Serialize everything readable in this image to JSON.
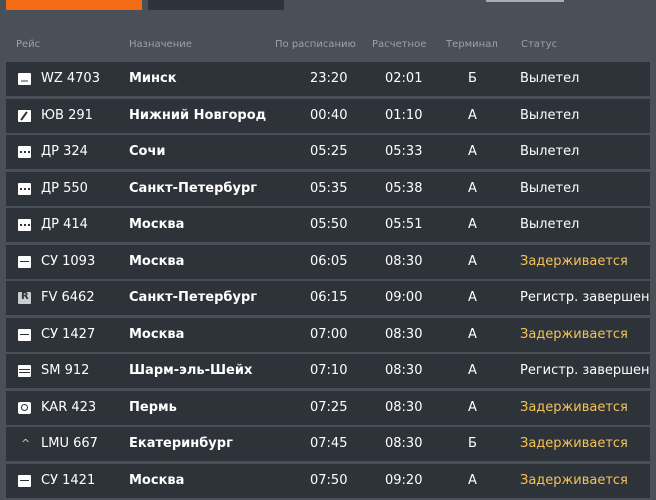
{
  "header": {
    "flight": "Рейс",
    "destination": "Назначение",
    "scheduled": "По расписанию",
    "estimated": "Расчетное",
    "terminal": "Терминал",
    "status": "Статус"
  },
  "flights": [
    {
      "icon": "wizz-icon",
      "icon_class": "wizz",
      "flight": "WZ 4703",
      "destination": "Минск",
      "scheduled": "23:20",
      "estimated": "02:01",
      "terminal": "Б",
      "status": "Вылетел",
      "delayed": false
    },
    {
      "icon": "slash-logo-icon",
      "icon_class": "slash",
      "flight": "ЮВ 291",
      "destination": "Нижний Новгород",
      "scheduled": "00:40",
      "estimated": "01:10",
      "terminal": "А",
      "status": "Вылетел",
      "delayed": false
    },
    {
      "icon": "dots-logo-icon",
      "icon_class": "dots",
      "flight": "ДР 324",
      "destination": "Сочи",
      "scheduled": "05:25",
      "estimated": "05:33",
      "terminal": "А",
      "status": "Вылетел",
      "delayed": false
    },
    {
      "icon": "dots-logo-icon",
      "icon_class": "dots",
      "flight": "ДР 550",
      "destination": "Санкт-Петербург",
      "scheduled": "05:35",
      "estimated": "05:38",
      "terminal": "А",
      "status": "Вылетел",
      "delayed": false
    },
    {
      "icon": "dots-logo-icon",
      "icon_class": "dots",
      "flight": "ДР 414",
      "destination": "Москва",
      "scheduled": "05:50",
      "estimated": "05:51",
      "terminal": "А",
      "status": "Вылетел",
      "delayed": false
    },
    {
      "icon": "line-logo-icon",
      "icon_class": "line",
      "flight": "СУ 1093",
      "destination": "Москва",
      "scheduled": "06:05",
      "estimated": "08:30",
      "terminal": "А",
      "status": "Задерживается",
      "delayed": true
    },
    {
      "icon": "r-logo-icon",
      "icon_class": "rlogo",
      "flight": "FV 6462",
      "destination": "Санкт-Петербург",
      "scheduled": "06:15",
      "estimated": "09:00",
      "terminal": "А",
      "status": "Регистр. завершен",
      "delayed": false
    },
    {
      "icon": "line-logo-icon",
      "icon_class": "line",
      "flight": "СУ 1427",
      "destination": "Москва",
      "scheduled": "07:00",
      "estimated": "08:30",
      "terminal": "А",
      "status": "Задерживается",
      "delayed": true
    },
    {
      "icon": "stripes-logo-icon",
      "icon_class": "stripes",
      "flight": "SM 912",
      "destination": "Шарм-эль-Шейх",
      "scheduled": "07:10",
      "estimated": "08:30",
      "terminal": "А",
      "status": "Регистр. завершен",
      "delayed": false
    },
    {
      "icon": "ring-logo-icon",
      "icon_class": "ring",
      "flight": "KAR 423",
      "destination": "Пермь",
      "scheduled": "07:25",
      "estimated": "08:30",
      "terminal": "А",
      "status": "Задерживается",
      "delayed": true
    },
    {
      "icon": "caret-logo-icon",
      "icon_class": "caret",
      "flight": "LMU 667",
      "destination": "Екатеринбург",
      "scheduled": "07:45",
      "estimated": "08:30",
      "terminal": "Б",
      "status": "Задерживается",
      "delayed": true
    },
    {
      "icon": "line-logo-icon",
      "icon_class": "line",
      "flight": "СУ 1421",
      "destination": "Москва",
      "scheduled": "07:50",
      "estimated": "09:20",
      "terminal": "А",
      "status": "Задерживается",
      "delayed": true
    }
  ],
  "colors": {
    "background": "#4a5058",
    "row": "#2e3339",
    "accent": "#f26c15",
    "delayed": "#f3c358",
    "header_text": "#9aa1a9"
  }
}
